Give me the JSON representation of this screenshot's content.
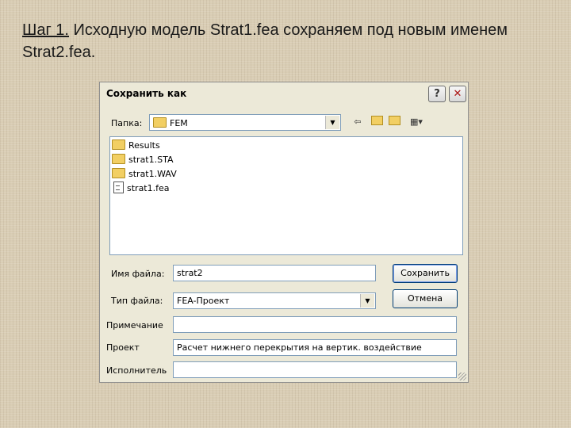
{
  "slide": {
    "step": "Шаг 1.",
    "title_rest": " Исходную модель Strat1.fea сохраняем под новым именем Strat2.fea."
  },
  "dialog": {
    "title": "Сохранить как",
    "help_glyph": "?",
    "close_glyph": "✕",
    "folder_label": "Папка:",
    "folder_value": "FEM",
    "files": [
      {
        "name": "Results",
        "icon": "folder-icon"
      },
      {
        "name": "strat1.STA",
        "icon": "folder-icon"
      },
      {
        "name": "strat1.WAV",
        "icon": "folder-icon"
      },
      {
        "name": "strat1.fea",
        "icon": "file-icon"
      }
    ],
    "filename_label": "Имя файла:",
    "filename_value": "strat2",
    "filetype_label": "Тип файла:",
    "filetype_value": "FEA-Проект",
    "save_button": "Сохранить",
    "cancel_button": "Отмена",
    "note_label": "Примечание",
    "note_value": "",
    "project_label": "Проект",
    "project_value": "Расчет нижнего перекрытия на вертик. воздействие",
    "author_label": "Исполнитель",
    "author_value": ""
  }
}
